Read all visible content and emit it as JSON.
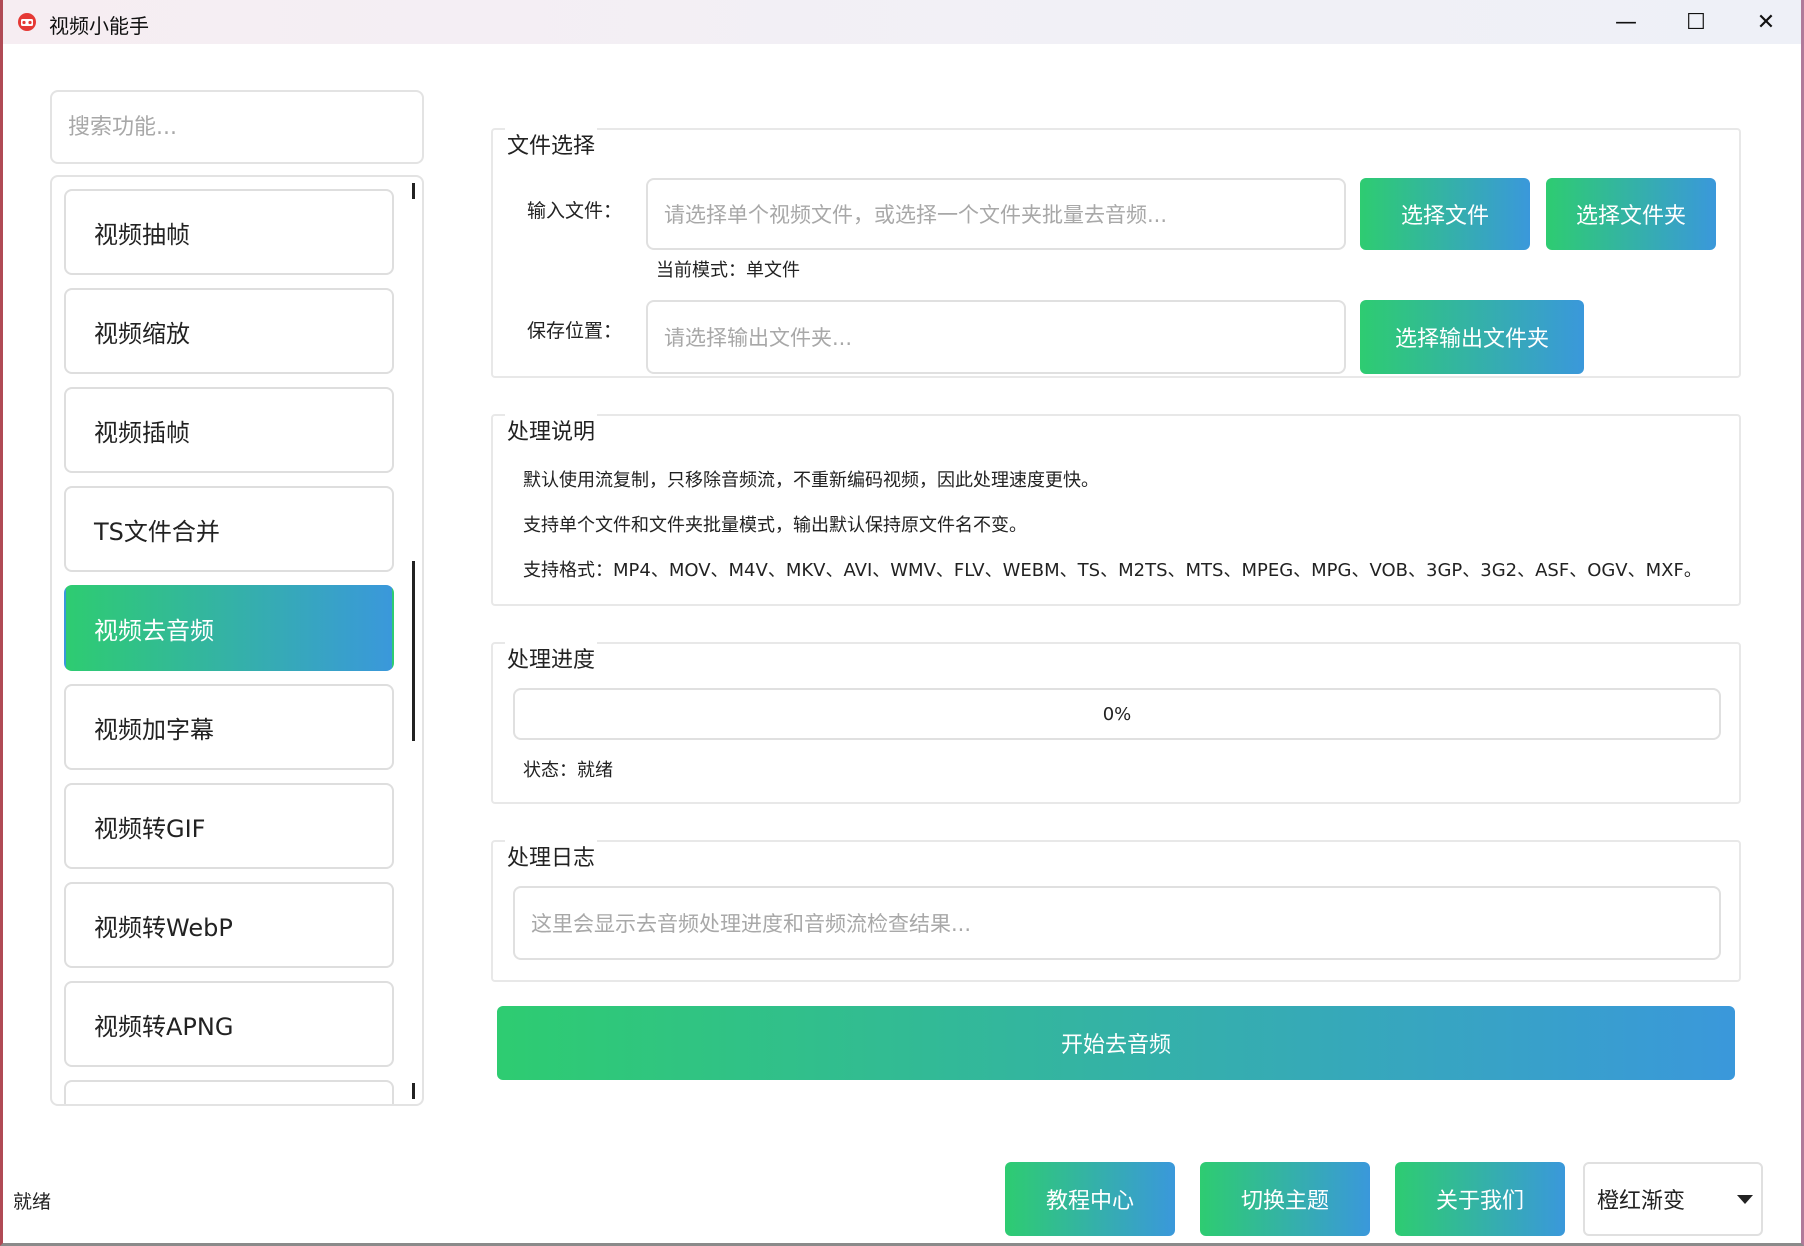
{
  "window": {
    "title": "视频小能手",
    "minimize_glyph": "—",
    "maximize_glyph": "☐",
    "close_glyph": "✕"
  },
  "sidebar": {
    "search_placeholder": "搜索功能...",
    "items": [
      {
        "label": "视频抽帧",
        "active": false
      },
      {
        "label": "视频缩放",
        "active": false
      },
      {
        "label": "视频插帧",
        "active": false
      },
      {
        "label": "TS文件合并",
        "active": false
      },
      {
        "label": "视频去音频",
        "active": true
      },
      {
        "label": "视频加字幕",
        "active": false
      },
      {
        "label": "视频转GIF",
        "active": false
      },
      {
        "label": "视频转WebP",
        "active": false
      },
      {
        "label": "视频转APNG",
        "active": false
      }
    ]
  },
  "file_select": {
    "title": "文件选择",
    "input_label": "输入文件：",
    "input_placeholder": "请选择单个视频文件，或选择一个文件夹批量去音频...",
    "select_file_button": "选择文件",
    "select_folder_button": "选择文件夹",
    "mode_text": "当前模式：单文件",
    "save_label": "保存位置：",
    "save_placeholder": "请选择输出文件夹...",
    "select_output_button": "选择输出文件夹"
  },
  "description": {
    "title": "处理说明",
    "lines": [
      "默认使用流复制，只移除音频流，不重新编码视频，因此处理速度更快。",
      "支持单个文件和文件夹批量模式，输出默认保持原文件名不变。",
      "支持格式：MP4、MOV、M4V、MKV、AVI、WMV、FLV、WEBM、TS、M2TS、MTS、MPEG、MPG、VOB、3GP、3G2、ASF、OGV、MXF。"
    ]
  },
  "progress": {
    "title": "处理进度",
    "value_percent": 0,
    "text": "0%",
    "status": "状态：就绪"
  },
  "log": {
    "title": "处理日志",
    "placeholder": "这里会显示去音频处理进度和音频流检查结果..."
  },
  "start_button": "开始去音频",
  "footer": {
    "status": "就绪",
    "tutorial_button": "教程中心",
    "theme_button": "切换主题",
    "about_button": "关于我们",
    "theme_select_value": "橙红渐变"
  },
  "colors": {
    "gradient_start": "#2ecc71",
    "gradient_end": "#3a98db"
  }
}
